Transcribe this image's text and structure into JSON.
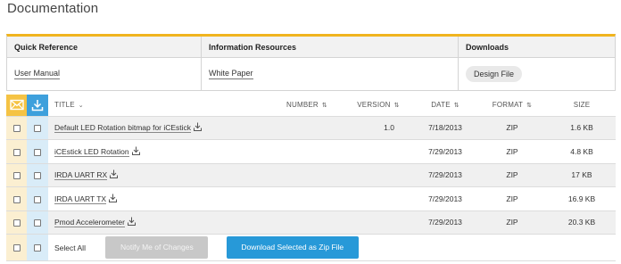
{
  "page": {
    "title": "Documentation"
  },
  "quick_reference": {
    "columns": [
      {
        "header": "Quick Reference",
        "item": "User Manual"
      },
      {
        "header": "Information Resources",
        "item": "White Paper"
      },
      {
        "header": "Downloads",
        "item": "Design File"
      }
    ]
  },
  "table": {
    "headers": {
      "title": "TITLE",
      "number": "NUMBER",
      "version": "VERSION",
      "date": "DATE",
      "format": "FORMAT",
      "size": "SIZE"
    },
    "rows": [
      {
        "title": "Default LED Rotation bitmap for iCEstick",
        "number": "",
        "version": "1.0",
        "date": "7/18/2013",
        "format": "ZIP",
        "size": "1.6 KB"
      },
      {
        "title": "iCEstick LED Rotation",
        "number": "",
        "version": "",
        "date": "7/29/2013",
        "format": "ZIP",
        "size": "4.8 KB"
      },
      {
        "title": "IRDA UART RX",
        "number": "",
        "version": "",
        "date": "7/29/2013",
        "format": "ZIP",
        "size": "17 KB"
      },
      {
        "title": "IRDA UART TX",
        "number": "",
        "version": "",
        "date": "7/29/2013",
        "format": "ZIP",
        "size": "16.9 KB"
      },
      {
        "title": "Pmod Accelerometer",
        "number": "",
        "version": "",
        "date": "7/29/2013",
        "format": "ZIP",
        "size": "20.3 KB"
      }
    ],
    "footer": {
      "select_all": "Select All",
      "notify_button": "Notify Me of Changes",
      "download_button": "Download Selected as Zip File"
    }
  },
  "colors": {
    "accent_yellow": "#f0b41e",
    "accent_blue": "#2799d8",
    "notify_column": "#fbefd1",
    "download_column": "#d9ecf8"
  },
  "icons": {
    "notify_header": "envelope-icon",
    "download_header": "download-icon",
    "row_download": "download-file-icon",
    "sort": "sort-icon"
  }
}
